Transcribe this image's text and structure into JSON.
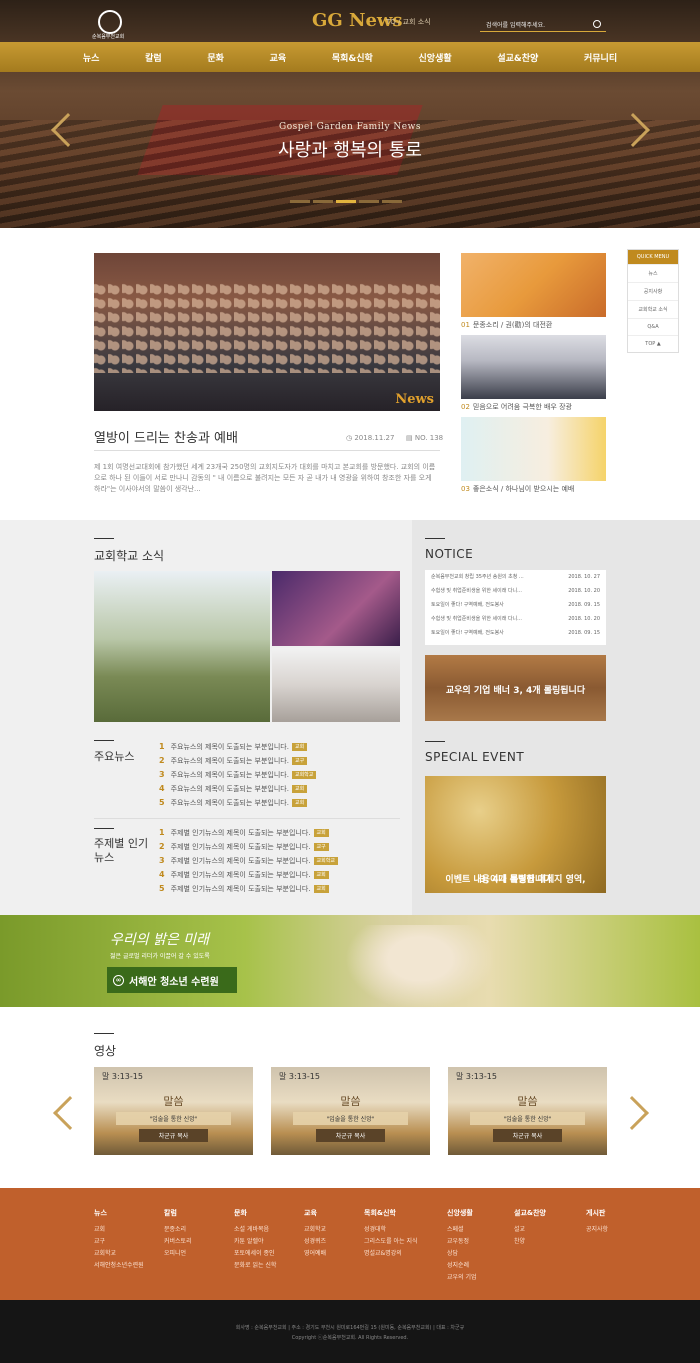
{
  "header": {
    "logo_text": "순복음부천교회",
    "brand": "GG News",
    "brand_sub": "TO / 교회 소식",
    "search_placeholder": "검색어를 입력해주세요."
  },
  "nav": [
    "뉴스",
    "칼럼",
    "문화",
    "교육",
    "목회&신학",
    "신앙생활",
    "설교&찬양",
    "커뮤니티"
  ],
  "hero": {
    "subtitle": "Gospel Garden Family News",
    "title": "사랑과 행복의 통로"
  },
  "main": {
    "photo_brand": "News",
    "headline": "열방이 드리는 찬송과 예배",
    "date": "2018.11.27",
    "no": "NO. 138",
    "body": "제 1회 여명선교대회에 참가했던 세계 23개국 250명의 교회지도자가 대회를 마치고 본교회를 방문했다. 교회의 이름으로 하나 된 이들이 서로 만나니 감동의 \" 내 이름으로 불려지는 모든 자 곧 내가 내 영광을 위하여 창조한 자를 오게 하라\"는 이사야서의 말씀이 생각난..."
  },
  "thumbs": [
    {
      "no": "01",
      "caption": "문종소리 / 권(勸)의 대전환"
    },
    {
      "no": "02",
      "caption": "믿음으로 어려움 극복한 배우 장광"
    },
    {
      "no": "03",
      "caption": "좋은소식 / 하나님이 받으시는 예배"
    }
  ],
  "quick_menu": {
    "title": "QUICK MENU",
    "items": [
      "뉴스",
      "공지사항",
      "교회학교 소식",
      "Q&A"
    ],
    "top": "TOP"
  },
  "school": {
    "title": "교회학교 소식"
  },
  "news_lists": [
    {
      "title": "주요뉴스",
      "rows": [
        {
          "n": "1",
          "t": "주요뉴스의 제목이 도출되는 부분입니다.",
          "tag": "교회"
        },
        {
          "n": "2",
          "t": "주요뉴스의 제목이 도출되는 부분입니다.",
          "tag": "교구"
        },
        {
          "n": "3",
          "t": "주요뉴스의 제목이 도출되는 부분입니다.",
          "tag": "교회학교"
        },
        {
          "n": "4",
          "t": "주요뉴스의 제목이 도출되는 부분입니다.",
          "tag": "교회"
        },
        {
          "n": "5",
          "t": "주요뉴스의 제목이 도출되는 부분입니다.",
          "tag": "교회"
        }
      ]
    },
    {
      "title": "주제별 인기뉴스",
      "rows": [
        {
          "n": "1",
          "t": "주제별 인기뉴스의 제목이 도출되는 부분입니다.",
          "tag": "교회"
        },
        {
          "n": "2",
          "t": "주제별 인기뉴스의 제목이 도출되는 부분입니다.",
          "tag": "교구"
        },
        {
          "n": "3",
          "t": "주제별 인기뉴스의 제목이 도출되는 부분입니다.",
          "tag": "교회학교"
        },
        {
          "n": "4",
          "t": "주제별 인기뉴스의 제목이 도출되는 부분입니다.",
          "tag": "교회"
        },
        {
          "n": "5",
          "t": "주제별 인기뉴스의 제목이 도출되는 부분입니다.",
          "tag": "교회"
        }
      ]
    }
  ],
  "notice": {
    "title": "NOTICE",
    "rows": [
      {
        "t": "순복음부천교회 창립 35주년 송원의 초청 ...",
        "d": "2018. 10. 27"
      },
      {
        "t": "수험생 및 취업준비생을 위한 세이래 다니...",
        "d": "2018. 10. 20"
      },
      {
        "t": "토요일이 좋다! 구역예배, 전도봉사",
        "d": "2018. 09. 15"
      },
      {
        "t": "수험생 및 취업준비생을 위한 세이래 다니...",
        "d": "2018. 10. 20"
      },
      {
        "t": "토요일이 좋다! 구역예배, 전도봉사",
        "d": "2018. 09. 15"
      }
    ],
    "banner": "교우의 기업 배너 3, 4개 롤링됩니다"
  },
  "special": {
    "title": "SPECIAL EVENT",
    "text1": "이벤트 내용이나 특별한 메세지 영역,",
    "text2": "3, 4개 롤링됩니다"
  },
  "promo": {
    "title": "우리의 밝은 미래",
    "sub": "젊은 글로벌 리더가 이끌어 갈 수 있도록",
    "button": "서해안 청소년 수련원"
  },
  "video": {
    "title": "영상",
    "items": [
      {
        "a": "말 3:13-15",
        "b": "말씀",
        "c": "\"입술을 통한 신앙\"",
        "d": "차군규 목사"
      },
      {
        "a": "말 3:13-15",
        "b": "말씀",
        "c": "\"입술을 통한 신앙\"",
        "d": "차군규 목사"
      },
      {
        "a": "말 3:13-15",
        "b": "말씀",
        "c": "\"입술을 통한 신앙\"",
        "d": "차군규 목사"
      }
    ]
  },
  "footer": {
    "cols": [
      {
        "h": "뉴스",
        "i": [
          "교회",
          "교구",
          "교회학교",
          "서해안청소년수련원"
        ]
      },
      {
        "h": "칼럼",
        "i": [
          "문종소리",
          "커버스토리",
          "오피니언"
        ]
      },
      {
        "h": "문화",
        "i": [
          "소설 게바복음",
          "카툰 알렐야",
          "포토에세이 종인",
          "문화로 읽는 신학"
        ]
      },
      {
        "h": "교육",
        "i": [
          "교회학교",
          "성경퀴즈",
          "영어예배"
        ]
      },
      {
        "h": "목회&신학",
        "i": [
          "성경대학",
          "그리스도를 아는 지식",
          "명설교&명강의"
        ]
      },
      {
        "h": "신앙생활",
        "i": [
          "스페셜",
          "교우동정",
          "상담",
          "성지순례",
          "교우의 기업"
        ]
      },
      {
        "h": "설교&찬양",
        "i": [
          "설교",
          "찬양"
        ]
      },
      {
        "h": "게시판",
        "i": [
          "공지사항"
        ]
      }
    ],
    "line1": "회사명 : 순복음부천교회   |   주소 : 경기도 부천시 원미로164번길 15 (원미동, 순복음부천교회)   |   대표 : 차군규",
    "line2": "Copyright ⓒ순복음부천교회. All Rights Reserved."
  }
}
